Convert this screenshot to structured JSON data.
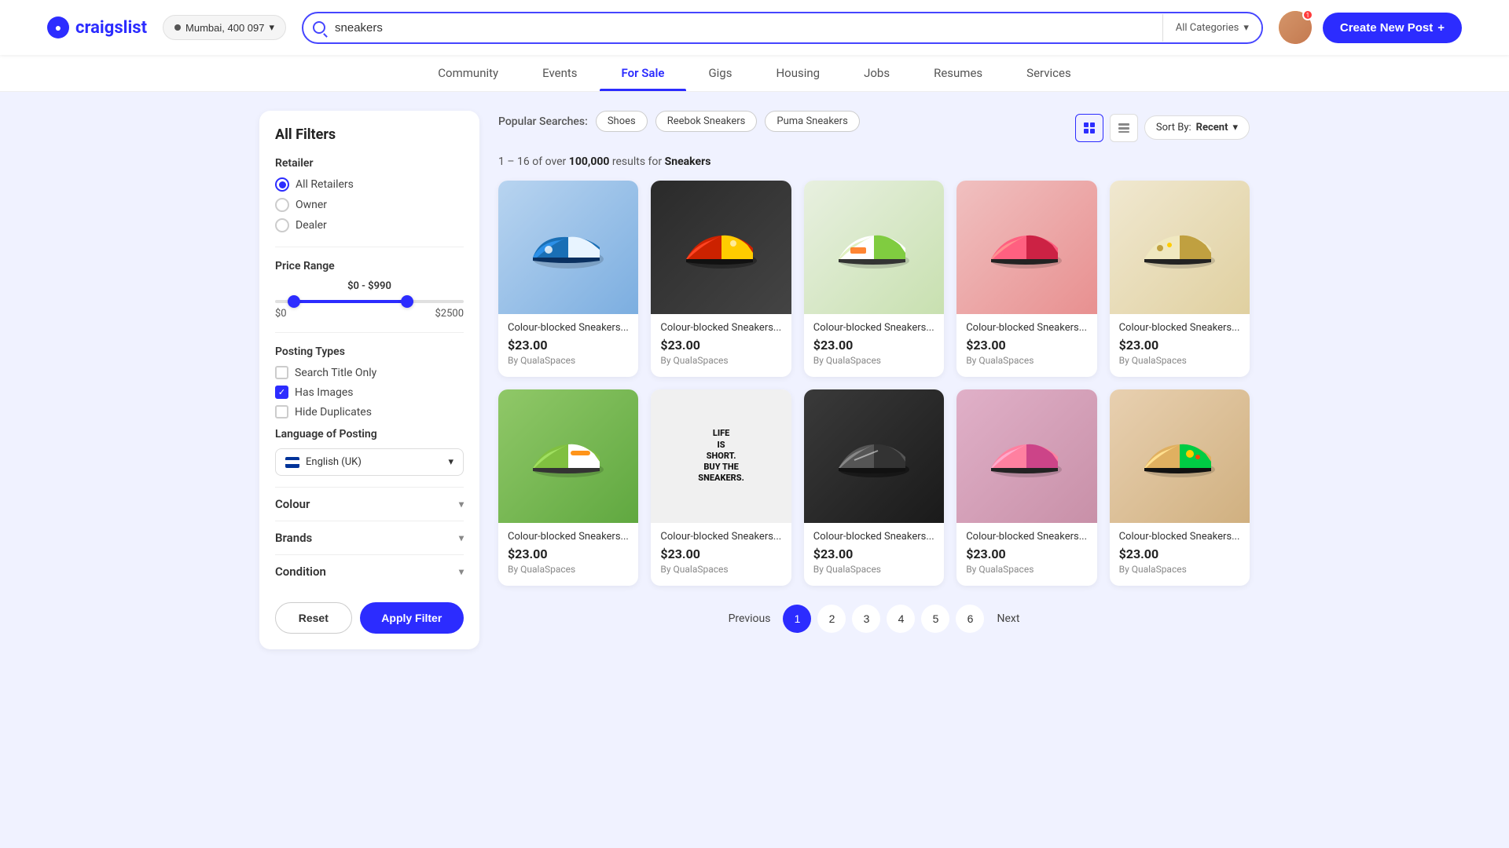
{
  "header": {
    "logo_text": "craigslist",
    "location": "Mumbai, 400 097",
    "search_value": "sneakers",
    "search_placeholder": "sneakers",
    "category": "All Categories",
    "create_post_label": "Create New Post"
  },
  "nav": {
    "items": [
      {
        "id": "community",
        "label": "Community",
        "active": false
      },
      {
        "id": "events",
        "label": "Events",
        "active": false
      },
      {
        "id": "for-sale",
        "label": "For Sale",
        "active": true
      },
      {
        "id": "gigs",
        "label": "Gigs",
        "active": false
      },
      {
        "id": "housing",
        "label": "Housing",
        "active": false
      },
      {
        "id": "jobs",
        "label": "Jobs",
        "active": false
      },
      {
        "id": "resumes",
        "label": "Resumes",
        "active": false
      },
      {
        "id": "services",
        "label": "Services",
        "active": false
      }
    ]
  },
  "sidebar": {
    "title": "All Filters",
    "retailer": {
      "label": "Retailer",
      "options": [
        {
          "id": "all",
          "label": "All Retailers",
          "selected": true
        },
        {
          "id": "owner",
          "label": "Owner",
          "selected": false
        },
        {
          "id": "dealer",
          "label": "Dealer",
          "selected": false
        }
      ]
    },
    "price_range": {
      "label": "Price Range",
      "display": "$0 - $990",
      "min_label": "$0",
      "max_label": "$2500"
    },
    "posting_types": {
      "label": "Posting Types",
      "options": [
        {
          "id": "title-only",
          "label": "Search Title Only",
          "checked": false
        },
        {
          "id": "has-images",
          "label": "Has Images",
          "checked": true
        },
        {
          "id": "hide-duplicates",
          "label": "Hide Duplicates",
          "checked": false
        }
      ]
    },
    "language": {
      "label": "Language of Posting",
      "value": "English (UK)"
    },
    "colour": {
      "label": "Colour"
    },
    "brands": {
      "label": "Brands"
    },
    "condition": {
      "label": "Condition"
    },
    "reset_label": "Reset",
    "apply_label": "Apply Filter"
  },
  "popular_searches": {
    "label": "Popular Searches:",
    "tags": [
      "Shoes",
      "Reebok Sneakers",
      "Puma Sneakers"
    ]
  },
  "results": {
    "range_start": 1,
    "range_end": 16,
    "total": "100,000",
    "keyword": "Sneakers"
  },
  "sort": {
    "label": "Sort By:",
    "value": "Recent"
  },
  "products": [
    {
      "id": 1,
      "title": "Colour-blocked Sneakers...",
      "price": "$23.00",
      "seller": "By QualaSpaces",
      "img_class": "card-img-1"
    },
    {
      "id": 2,
      "title": "Colour-blocked Sneakers...",
      "price": "$23.00",
      "seller": "By QualaSpaces",
      "img_class": "card-img-2"
    },
    {
      "id": 3,
      "title": "Colour-blocked Sneakers...",
      "price": "$23.00",
      "seller": "By QualaSpaces",
      "img_class": "card-img-3"
    },
    {
      "id": 4,
      "title": "Colour-blocked Sneakers...",
      "price": "$23.00",
      "seller": "By QualaSpaces",
      "img_class": "card-img-4"
    },
    {
      "id": 5,
      "title": "Colour-blocked Sneakers...",
      "price": "$23.00",
      "seller": "By QualaSpaces",
      "img_class": "card-img-5"
    },
    {
      "id": 6,
      "title": "Colour-blocked Sneakers...",
      "price": "$23.00",
      "seller": "By QualaSpaces",
      "img_class": "card-img-6"
    },
    {
      "id": 7,
      "title": "Colour-blocked Sneakers...",
      "price": "$23.00",
      "seller": "By QualaSpaces",
      "img_class": "card-img-7"
    },
    {
      "id": 8,
      "title": "Colour-blocked Sneakers...",
      "price": "$23.00",
      "seller": "By QualaSpaces",
      "img_class": "card-img-8"
    },
    {
      "id": 9,
      "title": "Colour-blocked Sneakers...",
      "price": "$23.00",
      "seller": "By QualaSpaces",
      "img_class": "card-img-9"
    },
    {
      "id": 10,
      "title": "Colour-blocked Sneakers...",
      "price": "$23.00",
      "seller": "By QualaSpaces",
      "img_class": "card-img-10"
    }
  ],
  "pagination": {
    "previous": "Previous",
    "next": "Next",
    "current": 1,
    "pages": [
      1,
      2,
      3,
      4,
      5,
      6
    ]
  }
}
